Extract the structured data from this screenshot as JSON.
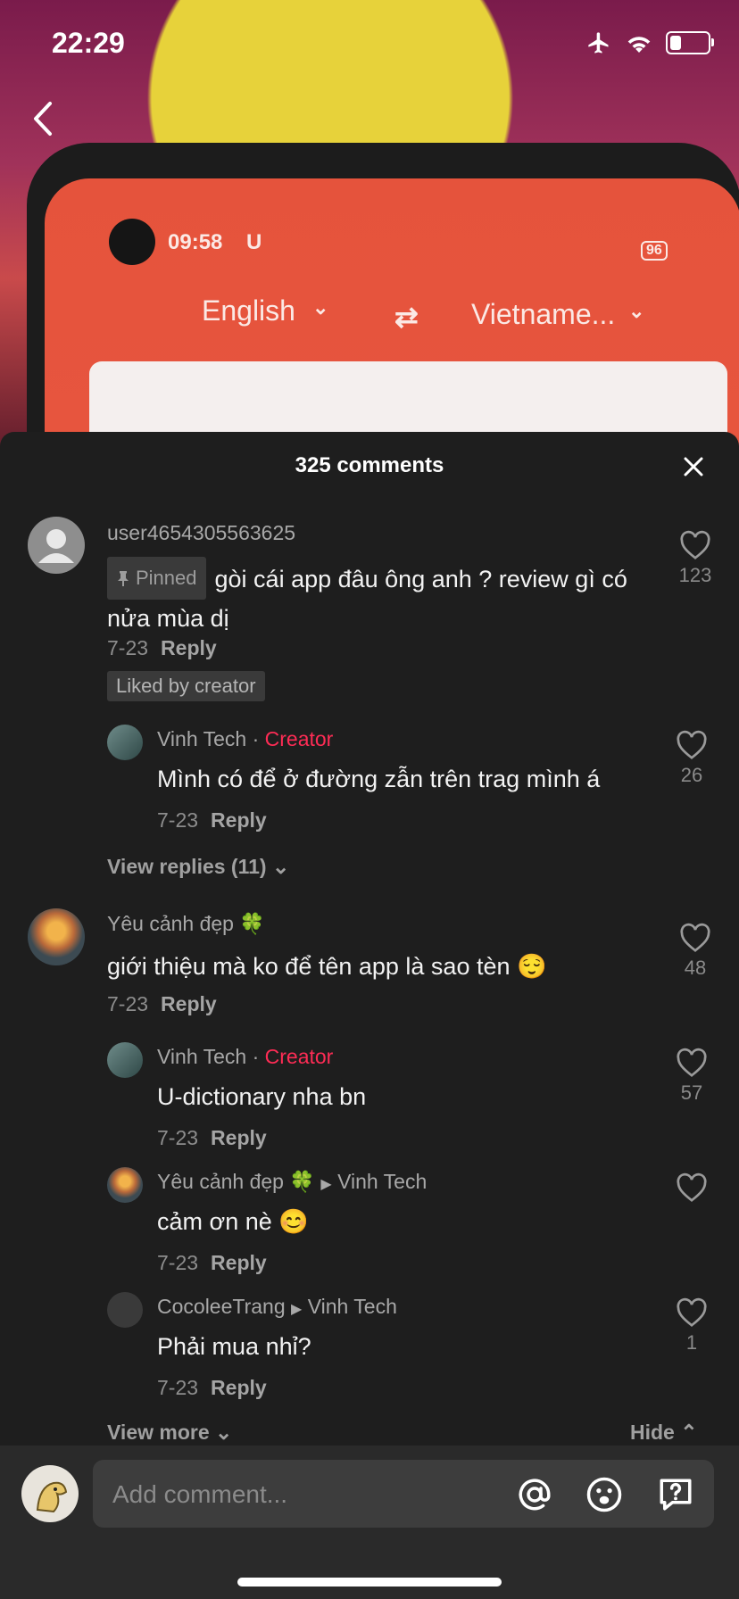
{
  "status": {
    "time": "22:29",
    "battery_level": 0.3
  },
  "video": {
    "time": "09:58",
    "carrier": "U",
    "source_lang": "English",
    "target_lang": "Vietname...",
    "battery": "96"
  },
  "sheet": {
    "title": "325 comments"
  },
  "comments": [
    {
      "username": "user4654305563625",
      "pinned": "Pinned",
      "text": "gòi cái app đâu ông anh ? review gì có nửa mùa dị",
      "date": "7-23",
      "reply": "Reply",
      "likes": "123",
      "liked_by": "Liked by creator"
    },
    {
      "username": "Vinh Tech",
      "badge": "Creator",
      "text": "Mình có để ở đường zẫn trên trag mình á",
      "date": "7-23",
      "reply": "Reply",
      "likes": "26"
    },
    {
      "view_replies": "View replies (11)"
    },
    {
      "username": "Yêu cảnh đẹp 🍀",
      "text": "giới thiệu mà ko để tên app là sao tèn 😌",
      "date": "7-23",
      "reply": "Reply",
      "likes": "48"
    },
    {
      "username": "Vinh Tech",
      "badge": "Creator",
      "text": "U-dictionary nha bn",
      "date": "7-23",
      "reply": "Reply",
      "likes": "57"
    },
    {
      "username": "Yêu cảnh đẹp 🍀",
      "reply_to": "Vinh Tech",
      "text": "cảm ơn nè 😊",
      "date": "7-23",
      "reply": "Reply",
      "likes": ""
    },
    {
      "username": "CocoleeTrang",
      "reply_to": "Vinh Tech",
      "text": "Phải mua nhỉ?",
      "date": "7-23",
      "reply": "Reply",
      "likes": "1"
    }
  ],
  "footer_links": {
    "view_more": "View more",
    "hide": "Hide"
  },
  "composer": {
    "placeholder": "Add comment..."
  },
  "icons": [
    "airplane-icon",
    "wifi-icon",
    "battery-icon",
    "back-icon",
    "close-icon",
    "heart-icon",
    "pin-icon",
    "at-icon",
    "emoji-icon",
    "question-icon"
  ]
}
